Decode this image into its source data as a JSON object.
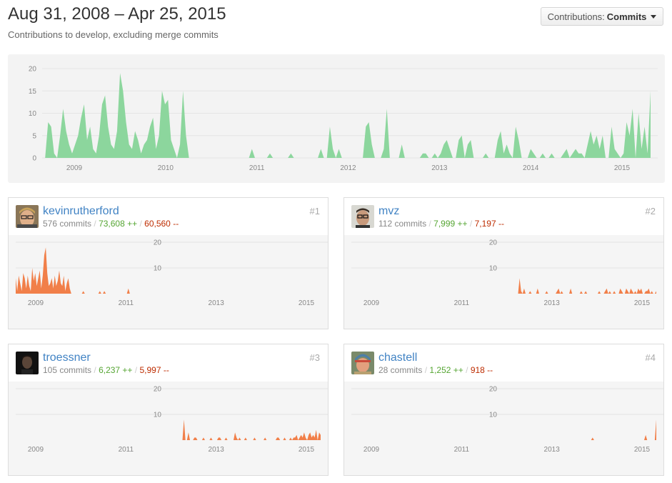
{
  "header": {
    "title": "Aug 31, 2008 – Apr 25, 2015",
    "subtitle": "Contributions to develop, excluding merge commits",
    "contributions_label": "Contributions:",
    "contributions_value": "Commits"
  },
  "colors": {
    "main_area": "#8cd69d",
    "user_area": "#f17f49",
    "link": "#4183c4",
    "additions": "#55a532",
    "deletions": "#bd2c00"
  },
  "chart_data": [
    {
      "type": "area",
      "series": [
        {
          "values": [
            0,
            0,
            8,
            7,
            1,
            0,
            5,
            11,
            6,
            3,
            1,
            3,
            5,
            9,
            12,
            4,
            7,
            2,
            1,
            5,
            12,
            14,
            7,
            3,
            2,
            6,
            19,
            15,
            8,
            3,
            2,
            6,
            4,
            1,
            3,
            4,
            7,
            9,
            2,
            5,
            15,
            12,
            13,
            4,
            2,
            0,
            3,
            15,
            5,
            0,
            0,
            0,
            0,
            0,
            0,
            0,
            0,
            0,
            0,
            0,
            0,
            0,
            0,
            0,
            0,
            0,
            0,
            0,
            0,
            0,
            2,
            0,
            0,
            0,
            0,
            0,
            1,
            0,
            0,
            0,
            0,
            0,
            0,
            1,
            0,
            0,
            0,
            0,
            0,
            0,
            0,
            0,
            0,
            2,
            0,
            0,
            7,
            2,
            0,
            2,
            0,
            0,
            0,
            0,
            0,
            0,
            0,
            0,
            7,
            8,
            3,
            0,
            0,
            0,
            2,
            11,
            0,
            0,
            0,
            0,
            3,
            0,
            0,
            0,
            0,
            0,
            0,
            1,
            1,
            0,
            0,
            1,
            0,
            1,
            3,
            4,
            2,
            0,
            0,
            4,
            5,
            0,
            3,
            4,
            0,
            0,
            0,
            0,
            1,
            0,
            0,
            0,
            4,
            6,
            1,
            3,
            1,
            0,
            7,
            4,
            0,
            0,
            0,
            2,
            1,
            0,
            0,
            1,
            0,
            0,
            1,
            0,
            0,
            0,
            1,
            2,
            0,
            1,
            2,
            1,
            1,
            0,
            3,
            6,
            3,
            5,
            2,
            5,
            0,
            0,
            7,
            2,
            1,
            0,
            1,
            8,
            5,
            11,
            0,
            10,
            2,
            7,
            1,
            15
          ]
        }
      ],
      "x_tick_labels": [
        "2009",
        "2010",
        "2011",
        "2012",
        "2013",
        "2014",
        "2015"
      ],
      "y_tick_labels": [
        "0",
        "5",
        "10",
        "15",
        "20"
      ],
      "ylim": [
        0,
        20
      ]
    },
    {
      "type": "area",
      "series": [
        {
          "values": [
            6,
            1,
            7,
            4,
            1,
            8,
            6,
            2,
            7,
            3,
            1,
            10,
            5,
            8,
            3,
            6,
            9,
            2,
            7,
            15,
            18,
            8,
            3,
            4,
            6,
            2,
            7,
            3,
            5,
            9,
            4,
            3,
            7,
            1,
            4,
            6,
            2,
            0,
            0,
            0,
            0,
            0,
            0,
            0,
            0,
            1,
            0,
            0,
            0,
            0,
            0,
            0,
            0,
            0,
            0,
            0,
            1,
            0,
            0,
            1,
            0,
            0,
            0,
            0,
            0,
            0,
            0,
            0,
            0,
            0,
            0,
            0,
            0,
            0,
            0,
            2,
            0,
            0,
            0,
            0,
            0,
            0,
            0,
            0,
            0,
            0,
            0,
            0,
            0,
            0,
            0,
            0,
            0,
            0,
            0,
            0,
            0,
            0,
            0,
            0,
            0,
            0,
            0,
            0,
            0,
            0,
            0,
            0,
            0,
            0,
            0,
            0,
            0,
            0,
            0,
            0,
            0,
            0,
            0,
            0,
            0,
            0,
            0,
            0,
            0,
            0,
            0,
            0,
            0,
            0,
            0,
            0,
            0,
            0,
            0,
            0,
            0,
            0,
            0,
            0,
            0,
            0,
            0,
            0,
            0,
            0,
            0,
            0,
            0,
            0,
            0,
            0,
            0,
            0,
            0,
            0,
            0,
            0,
            0,
            0,
            0,
            0,
            0,
            0,
            0,
            0,
            0,
            0,
            0,
            0,
            0,
            0,
            0,
            0,
            0,
            0,
            0,
            0,
            0,
            0,
            0,
            0,
            0,
            0,
            0,
            0,
            0,
            0,
            0,
            0,
            0,
            0,
            0,
            0,
            0,
            0,
            0,
            0,
            0,
            0,
            0,
            0,
            0,
            0
          ]
        }
      ],
      "x_tick_labels": [
        "2009",
        "2011",
        "2013",
        "2015"
      ],
      "y_tick_labels": [
        "10",
        "20"
      ],
      "ylim": [
        0,
        20
      ]
    },
    {
      "type": "area",
      "series": [
        {
          "values": [
            0,
            0,
            0,
            0,
            0,
            0,
            0,
            0,
            0,
            0,
            0,
            0,
            0,
            0,
            0,
            0,
            0,
            0,
            0,
            0,
            0,
            0,
            0,
            0,
            0,
            0,
            0,
            0,
            0,
            0,
            0,
            0,
            0,
            0,
            0,
            0,
            0,
            0,
            0,
            0,
            0,
            0,
            0,
            0,
            0,
            0,
            0,
            0,
            0,
            0,
            0,
            0,
            0,
            0,
            0,
            0,
            0,
            0,
            0,
            0,
            0,
            0,
            0,
            0,
            0,
            0,
            0,
            0,
            0,
            0,
            0,
            0,
            0,
            0,
            0,
            0,
            0,
            0,
            0,
            0,
            0,
            0,
            0,
            0,
            0,
            0,
            0,
            0,
            0,
            0,
            0,
            0,
            0,
            0,
            0,
            0,
            0,
            0,
            0,
            0,
            0,
            0,
            0,
            0,
            0,
            0,
            0,
            0,
            0,
            0,
            0,
            0,
            6,
            1,
            0,
            2,
            0,
            0,
            0,
            1,
            0,
            0,
            0,
            0,
            2,
            0,
            0,
            0,
            0,
            0,
            1,
            0,
            0,
            0,
            0,
            0,
            0,
            1,
            2,
            0,
            1,
            0,
            0,
            0,
            0,
            0,
            2,
            0,
            0,
            0,
            0,
            0,
            0,
            1,
            0,
            0,
            1,
            0,
            0,
            0,
            0,
            0,
            0,
            0,
            0,
            1,
            0,
            0,
            0,
            1,
            2,
            0,
            1,
            0,
            0,
            1,
            0,
            0,
            0,
            2,
            1,
            0,
            0,
            2,
            1,
            0,
            2,
            1,
            0,
            1,
            0,
            2,
            1,
            2,
            0,
            0,
            1,
            1,
            2,
            0,
            1,
            0,
            0,
            1
          ]
        }
      ],
      "x_tick_labels": [
        "2009",
        "2011",
        "2013",
        "2015"
      ],
      "y_tick_labels": [
        "10",
        "20"
      ],
      "ylim": [
        0,
        20
      ]
    },
    {
      "type": "area",
      "series": [
        {
          "values": [
            0,
            0,
            0,
            0,
            0,
            0,
            0,
            0,
            0,
            0,
            0,
            0,
            0,
            0,
            0,
            0,
            0,
            0,
            0,
            0,
            0,
            0,
            0,
            0,
            0,
            0,
            0,
            0,
            0,
            0,
            0,
            0,
            0,
            0,
            0,
            0,
            0,
            0,
            0,
            0,
            0,
            0,
            0,
            0,
            0,
            0,
            0,
            0,
            0,
            0,
            0,
            0,
            0,
            0,
            0,
            0,
            0,
            0,
            0,
            0,
            0,
            0,
            0,
            0,
            0,
            0,
            0,
            0,
            0,
            0,
            0,
            0,
            0,
            0,
            0,
            0,
            0,
            0,
            0,
            0,
            0,
            0,
            0,
            0,
            0,
            0,
            0,
            0,
            0,
            0,
            0,
            0,
            0,
            0,
            0,
            0,
            0,
            0,
            0,
            0,
            0,
            0,
            0,
            0,
            0,
            0,
            0,
            0,
            0,
            0,
            0,
            0,
            8,
            0,
            0,
            3,
            0,
            0,
            0,
            1,
            1,
            0,
            0,
            0,
            0,
            1,
            0,
            0,
            0,
            0,
            1,
            0,
            0,
            0,
            0,
            1,
            1,
            0,
            0,
            0,
            1,
            0,
            0,
            0,
            0,
            0,
            3,
            1,
            0,
            1,
            0,
            0,
            0,
            1,
            0,
            0,
            0,
            0,
            0,
            1,
            0,
            0,
            0,
            0,
            0,
            0,
            1,
            0,
            0,
            0,
            0,
            0,
            0,
            0,
            1,
            1,
            0,
            0,
            0,
            1,
            0,
            0,
            0,
            1,
            0,
            1,
            1,
            2,
            0,
            1,
            2,
            1,
            3,
            1,
            0,
            2,
            3,
            1,
            2,
            1,
            4,
            0,
            3,
            2
          ]
        }
      ],
      "x_tick_labels": [
        "2009",
        "2011",
        "2013",
        "2015"
      ],
      "y_tick_labels": [
        "10",
        "20"
      ],
      "ylim": [
        0,
        20
      ]
    },
    {
      "type": "area",
      "series": [
        {
          "values": [
            0,
            0,
            0,
            0,
            0,
            0,
            0,
            0,
            0,
            0,
            0,
            0,
            0,
            0,
            0,
            0,
            0,
            0,
            0,
            0,
            0,
            0,
            0,
            0,
            0,
            0,
            0,
            0,
            0,
            0,
            0,
            0,
            0,
            0,
            0,
            0,
            0,
            0,
            0,
            0,
            0,
            0,
            0,
            0,
            0,
            0,
            0,
            0,
            0,
            0,
            0,
            0,
            0,
            0,
            0,
            0,
            0,
            0,
            0,
            0,
            0,
            0,
            0,
            0,
            0,
            0,
            0,
            0,
            0,
            0,
            0,
            0,
            0,
            0,
            0,
            0,
            0,
            0,
            0,
            0,
            0,
            0,
            0,
            0,
            0,
            0,
            0,
            0,
            0,
            0,
            0,
            0,
            0,
            0,
            0,
            0,
            0,
            0,
            0,
            0,
            0,
            0,
            0,
            0,
            0,
            0,
            0,
            0,
            0,
            0,
            0,
            0,
            0,
            0,
            0,
            0,
            0,
            0,
            0,
            0,
            0,
            0,
            0,
            0,
            0,
            0,
            0,
            0,
            0,
            0,
            0,
            0,
            0,
            0,
            0,
            0,
            0,
            0,
            0,
            0,
            0,
            0,
            0,
            0,
            0,
            0,
            0,
            0,
            0,
            0,
            0,
            0,
            0,
            0,
            0,
            0,
            0,
            0,
            0,
            1,
            0,
            0,
            0,
            0,
            0,
            0,
            0,
            0,
            0,
            0,
            0,
            0,
            0,
            0,
            0,
            0,
            0,
            0,
            0,
            0,
            0,
            0,
            0,
            0,
            0,
            0,
            0,
            0,
            0,
            0,
            0,
            0,
            0,
            0,
            2,
            0,
            0,
            0,
            0,
            0,
            0,
            8
          ]
        }
      ],
      "x_tick_labels": [
        "2009",
        "2011",
        "2013",
        "2015"
      ],
      "y_tick_labels": [
        "10",
        "20"
      ],
      "ylim": [
        0,
        20
      ]
    }
  ],
  "contributors": [
    {
      "rank": "#1",
      "login": "kevinrutherford",
      "commits": "576 commits",
      "sep1": "/",
      "additions": "73,608 ++",
      "sep2": "/",
      "deletions": "60,560 --",
      "avatar_icon": "avatar-blond-glasses-icon"
    },
    {
      "rank": "#2",
      "login": "mvz",
      "commits": "112 commits",
      "sep1": "/",
      "additions": "7,999 ++",
      "sep2": "/",
      "deletions": "7,197 --",
      "avatar_icon": "avatar-glasses-icon"
    },
    {
      "rank": "#3",
      "login": "troessner",
      "commits": "105 commits",
      "sep1": "/",
      "additions": "6,237 ++",
      "sep2": "/",
      "deletions": "5,997 --",
      "avatar_icon": "avatar-dark-icon"
    },
    {
      "rank": "#4",
      "login": "chastell",
      "commits": "28 commits",
      "sep1": "/",
      "additions": "1,252 ++",
      "sep2": "/",
      "deletions": "918 --",
      "avatar_icon": "avatar-beanie-icon"
    }
  ]
}
